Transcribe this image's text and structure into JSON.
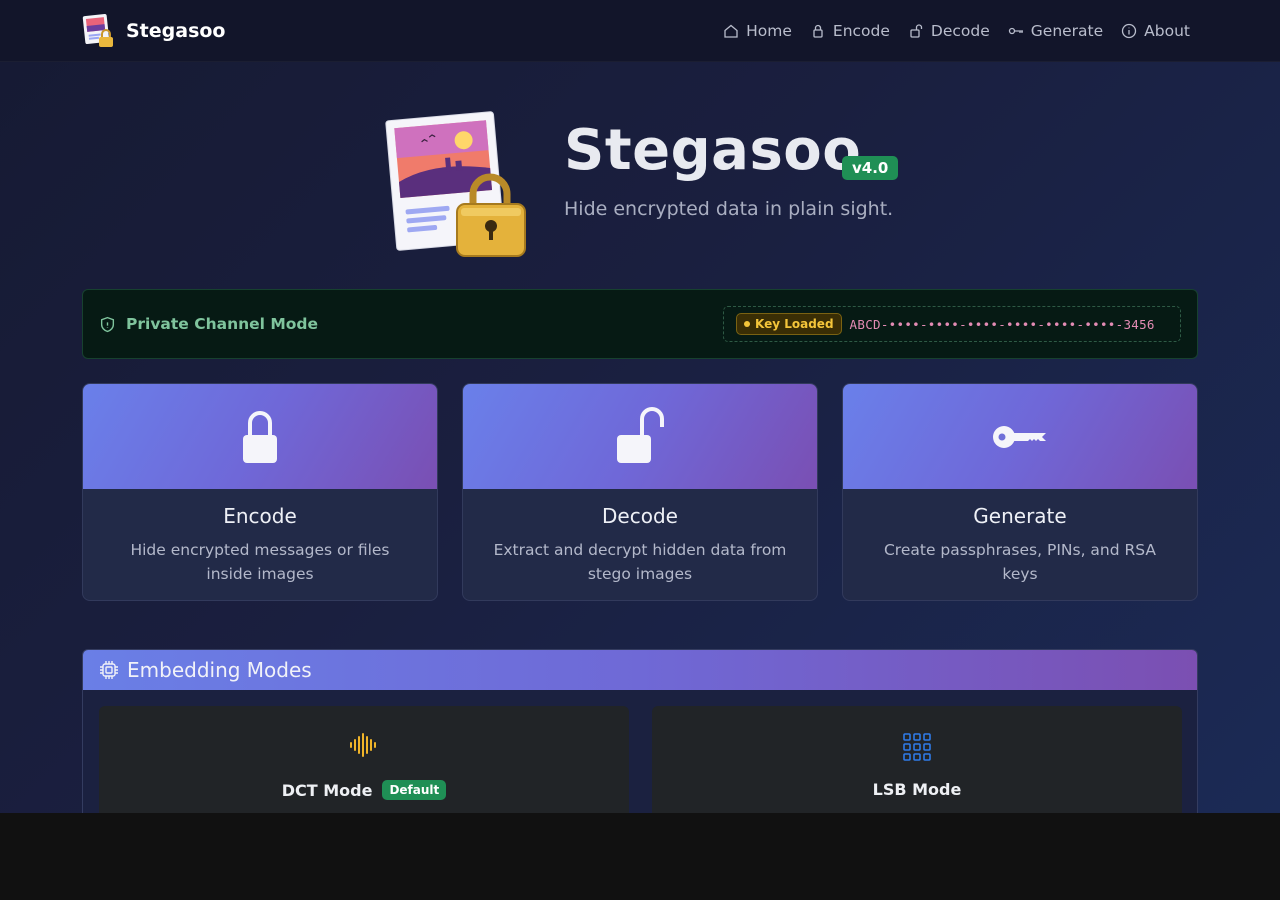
{
  "navbar": {
    "brand": "Stegasoo",
    "links": [
      {
        "label": "Home",
        "icon": "house-icon"
      },
      {
        "label": "Encode",
        "icon": "lock-icon"
      },
      {
        "label": "Decode",
        "icon": "unlock-icon"
      },
      {
        "label": "Generate",
        "icon": "key-icon"
      },
      {
        "label": "About",
        "icon": "info-icon"
      }
    ]
  },
  "hero": {
    "title": "Stegasoo",
    "version": "v4.0",
    "subtitle": "Hide encrypted data in plain sight."
  },
  "channel": {
    "label": "Private Channel Mode",
    "key_status": "Key Loaded",
    "key_value": "ABCD-••••-••••-••••-••••-••••-••••-3456"
  },
  "cards": [
    {
      "title": "Encode",
      "desc": "Hide encrypted messages or files inside images",
      "icon": "lock-icon"
    },
    {
      "title": "Decode",
      "desc": "Extract and decrypt hidden data from stego images",
      "icon": "unlock-icon"
    },
    {
      "title": "Generate",
      "desc": "Create passphrases, PINs, and RSA keys",
      "icon": "key-icon"
    }
  ],
  "modes": {
    "title": "Embedding Modes",
    "items": [
      {
        "title": "DCT Mode",
        "badge": "Default",
        "icon": "waveform-icon",
        "accent": "#f0b429"
      },
      {
        "title": "LSB Mode",
        "badge": "",
        "icon": "grid-icon",
        "accent": "#2f7be8"
      }
    ]
  },
  "colors": {
    "accent_green": "#1f8f55",
    "gradient_start": "#6a80ea",
    "gradient_end": "#7a4fb3",
    "key_gold": "#f3c53a"
  }
}
